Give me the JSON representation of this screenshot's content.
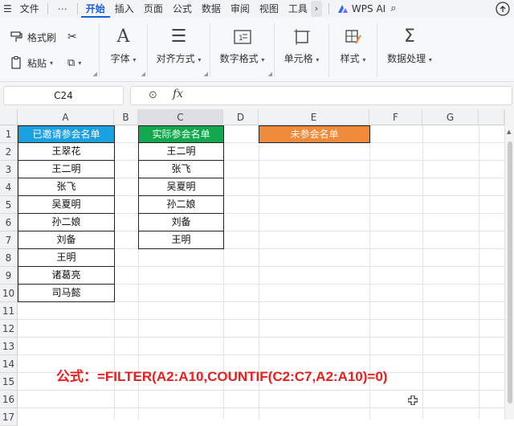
{
  "menu": {
    "file": "文件",
    "more": "⋯",
    "tabs": [
      "开始",
      "插入",
      "页面",
      "公式",
      "数据",
      "审阅",
      "视图",
      "工具"
    ],
    "active_tab": "开始",
    "ai_label": "WPS AI"
  },
  "ribbon": {
    "format_painter": "格式刷",
    "paste": "粘贴",
    "font": "字体",
    "align": "对齐方式",
    "number_format": "数字格式",
    "cell": "单元格",
    "style": "样式",
    "data_processing": "数据处理"
  },
  "formula_bar": {
    "name_box": "C24",
    "fx": "fx",
    "content": ""
  },
  "columns": [
    "A",
    "B",
    "C",
    "D",
    "E",
    "F",
    "G"
  ],
  "selected_column": "C",
  "rows": [
    "1",
    "2",
    "3",
    "4",
    "5",
    "6",
    "7",
    "8",
    "9",
    "10",
    "11",
    "12",
    "13",
    "14",
    "15",
    "16",
    "17"
  ],
  "table_a": {
    "header": "已邀请参会名单",
    "names": [
      "王翠花",
      "王二明",
      "张飞",
      "吴夏明",
      "孙二娘",
      "刘备",
      "王明",
      "诸葛亮",
      "司马懿"
    ]
  },
  "table_c": {
    "header": "实际参会名单",
    "names": [
      "王二明",
      "张飞",
      "吴夏明",
      "孙二娘",
      "刘备",
      "王明"
    ]
  },
  "table_e": {
    "header": "未参会名单"
  },
  "formula_note": "公式：=FILTER(A2:A10,COUNTIF(C2:C7,A2:A10)=0)",
  "colors": {
    "header_a": "#1ba1e2",
    "header_c": "#11a84e",
    "header_e": "#ef8a3b",
    "formula_text": "#e81f1f",
    "active_tab": "#1a5fd6"
  }
}
